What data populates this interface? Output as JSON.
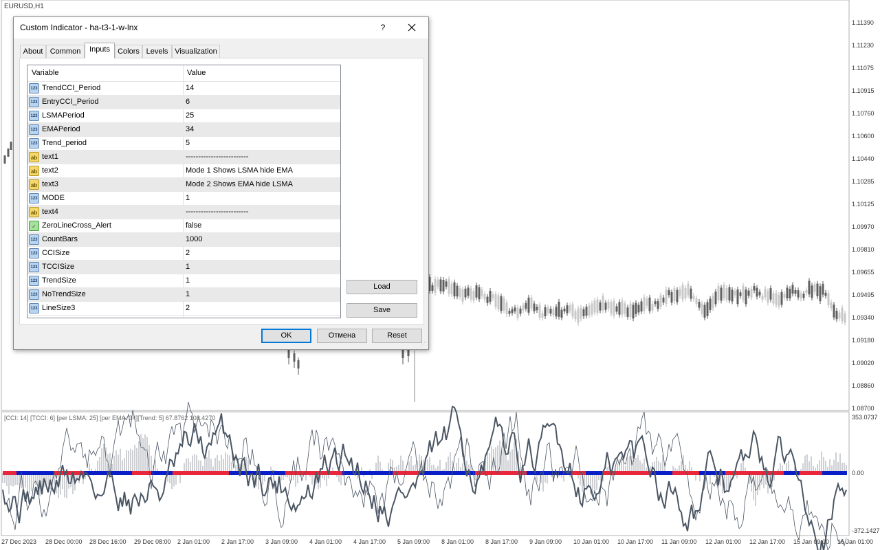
{
  "chart": {
    "symbol_title": "EURUSD,H1",
    "indicator_subtitle": "[CCI: 14] [TCCI: 6] [per LSMA: 25] [per EMA: 34][Trend: 5]  67.8762 108.4270",
    "price_labels": [
      "1.11390",
      "1.11230",
      "1.11075",
      "1.10915",
      "1.10760",
      "1.10600",
      "1.10440",
      "1.10285",
      "1.10125",
      "1.09970",
      "1.09810",
      "1.09655",
      "1.09495",
      "1.09340",
      "1.09180",
      "1.09020",
      "1.08860",
      "1.08700"
    ],
    "indicator_labels": [
      "353.0737",
      "0.00",
      "-372.1427"
    ],
    "time_labels": [
      "27 Dec 2023",
      "28 Dec 00:00",
      "28 Dec 16:00",
      "29 Dec 08:00",
      "2 Jan 01:00",
      "2 Jan 17:00",
      "3 Jan 09:00",
      "4 Jan 01:00",
      "4 Jan 17:00",
      "5 Jan 09:00",
      "8 Jan 01:00",
      "8 Jan 17:00",
      "9 Jan 09:00",
      "10 Jan 01:00",
      "10 Jan 17:00",
      "11 Jan 09:00",
      "12 Jan 01:00",
      "12 Jan 17:00",
      "15 Jan 09:00",
      "16 Jan 01:00"
    ],
    "colors": {
      "candle_up": "#c8c8c8",
      "candle_down": "#606060",
      "trend_red": "#e8273c",
      "trend_blue": "#0a1ec8",
      "cci_line": "#4a5563"
    }
  },
  "dialog": {
    "title": "Custom Indicator - ha-t3-1-w-lnx",
    "help_label": "?",
    "tabs": [
      {
        "label": "About"
      },
      {
        "label": "Common"
      },
      {
        "label": "Inputs"
      },
      {
        "label": "Colors"
      },
      {
        "label": "Levels"
      },
      {
        "label": "Visualization"
      }
    ],
    "active_tab": "Inputs",
    "grid": {
      "col_variable": "Variable",
      "col_value": "Value",
      "rows": [
        {
          "type": "int",
          "icon": "123",
          "name": "TrendCCI_Period",
          "value": "14"
        },
        {
          "type": "int",
          "icon": "123",
          "name": "EntryCCI_Period",
          "value": "6"
        },
        {
          "type": "int",
          "icon": "123",
          "name": "LSMAPeriod",
          "value": "25"
        },
        {
          "type": "int",
          "icon": "123",
          "name": "EMAPeriod",
          "value": "34"
        },
        {
          "type": "int",
          "icon": "123",
          "name": "Trend_period",
          "value": "5"
        },
        {
          "type": "str",
          "icon": "ab",
          "name": "text1",
          "value": "-------------------------"
        },
        {
          "type": "str",
          "icon": "ab",
          "name": "text2",
          "value": "Mode 1 Shows LSMA hide EMA"
        },
        {
          "type": "str",
          "icon": "ab",
          "name": "text3",
          "value": "Mode 2 Shows EMA hide LSMA"
        },
        {
          "type": "int",
          "icon": "123",
          "name": "MODE",
          "value": "1"
        },
        {
          "type": "str",
          "icon": "ab",
          "name": "text4",
          "value": "-------------------------"
        },
        {
          "type": "bool",
          "icon": "✓",
          "name": "ZeroLineCross_Alert",
          "value": "false"
        },
        {
          "type": "int",
          "icon": "123",
          "name": "CountBars",
          "value": "1000"
        },
        {
          "type": "int",
          "icon": "123",
          "name": "CCISize",
          "value": "2"
        },
        {
          "type": "int",
          "icon": "123",
          "name": "TCCISize",
          "value": "1"
        },
        {
          "type": "int",
          "icon": "123",
          "name": "TrendSize",
          "value": "1"
        },
        {
          "type": "int",
          "icon": "123",
          "name": "NoTrendSize",
          "value": "1"
        },
        {
          "type": "int",
          "icon": "123",
          "name": "LineSize3",
          "value": "2"
        }
      ]
    },
    "buttons": {
      "load": "Load",
      "save": "Save",
      "ok": "OK",
      "cancel": "Отмена",
      "reset": "Reset"
    }
  }
}
